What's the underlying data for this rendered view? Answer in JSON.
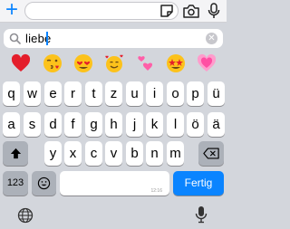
{
  "topbar": {
    "plus_icon": "plus-icon",
    "sticker_icon": "sticker-icon",
    "camera_icon": "camera-icon",
    "mic_icon": "microphone-icon",
    "message_value": ""
  },
  "search": {
    "value": "liebe",
    "icon": "search-icon",
    "clear_icon": "clear-icon"
  },
  "emojis": [
    "❤️",
    "😘",
    "😍",
    "🥰",
    "💕",
    "🤩",
    "💗"
  ],
  "keyboard": {
    "row1": [
      "q",
      "w",
      "e",
      "r",
      "t",
      "z",
      "u",
      "i",
      "o",
      "p",
      "ü"
    ],
    "row2": [
      "a",
      "s",
      "d",
      "f",
      "g",
      "h",
      "j",
      "k",
      "l",
      "ö",
      "ä"
    ],
    "row3": [
      "y",
      "x",
      "c",
      "v",
      "b",
      "n",
      "m"
    ],
    "numbers_label": "123",
    "space_hint": "12:16",
    "done_label": "Fertig",
    "shift_icon": "shift-icon",
    "delete_icon": "delete-icon",
    "emoji_icon": "emoji-icon",
    "globe_icon": "globe-icon",
    "dictation_icon": "microphone-icon"
  },
  "colors": {
    "accent": "#0a84ff",
    "keyboard_bg": "#d3d6dc",
    "key": "#ffffff",
    "key_dark": "#acb1b9"
  }
}
